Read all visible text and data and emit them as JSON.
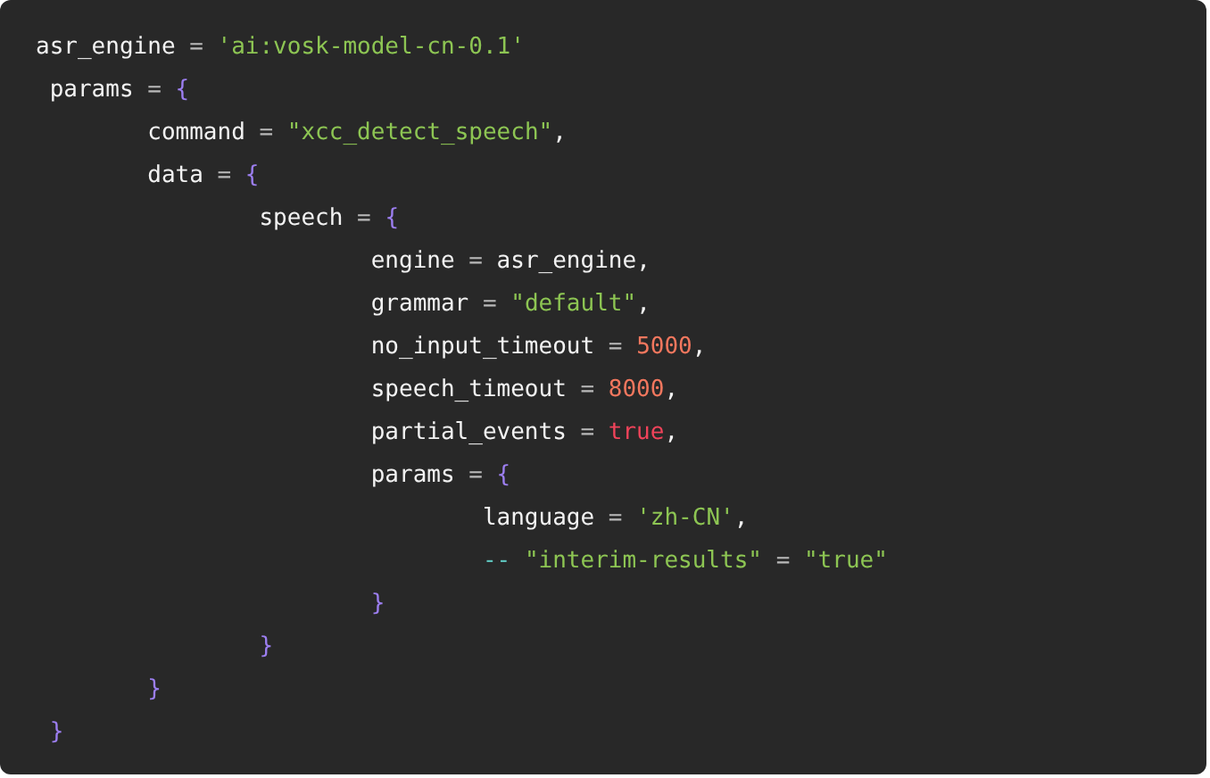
{
  "code_block": {
    "lines": [
      [
        {
          "kind": "plain",
          "text": "asr_engine "
        },
        {
          "kind": "operator",
          "text": "= "
        },
        {
          "kind": "string",
          "text": "'ai:vosk-model-cn-0.1'"
        }
      ],
      [
        {
          "kind": "plain",
          "text": " params "
        },
        {
          "kind": "operator",
          "text": "= "
        },
        {
          "kind": "brace",
          "text": "{"
        }
      ],
      [
        {
          "kind": "plain",
          "text": "\tcommand "
        },
        {
          "kind": "operator",
          "text": "= "
        },
        {
          "kind": "string",
          "text": "\"xcc_detect_speech\""
        },
        {
          "kind": "plain",
          "text": ","
        }
      ],
      [
        {
          "kind": "plain",
          "text": "\tdata "
        },
        {
          "kind": "operator",
          "text": "= "
        },
        {
          "kind": "brace",
          "text": "{"
        }
      ],
      [
        {
          "kind": "plain",
          "text": "\t\tspeech "
        },
        {
          "kind": "operator",
          "text": "= "
        },
        {
          "kind": "brace",
          "text": "{"
        }
      ],
      [
        {
          "kind": "plain",
          "text": "\t\t\tengine "
        },
        {
          "kind": "operator",
          "text": "= "
        },
        {
          "kind": "plain",
          "text": "asr_engine,"
        }
      ],
      [
        {
          "kind": "plain",
          "text": "\t\t\tgrammar "
        },
        {
          "kind": "operator",
          "text": "= "
        },
        {
          "kind": "string",
          "text": "\"default\""
        },
        {
          "kind": "plain",
          "text": ","
        }
      ],
      [
        {
          "kind": "plain",
          "text": "\t\t\tno_input_timeout "
        },
        {
          "kind": "operator",
          "text": "= "
        },
        {
          "kind": "number",
          "text": "5000"
        },
        {
          "kind": "plain",
          "text": ","
        }
      ],
      [
        {
          "kind": "plain",
          "text": "\t\t\tspeech_timeout "
        },
        {
          "kind": "operator",
          "text": "= "
        },
        {
          "kind": "number",
          "text": "8000"
        },
        {
          "kind": "plain",
          "text": ","
        }
      ],
      [
        {
          "kind": "plain",
          "text": "\t\t\tpartial_events "
        },
        {
          "kind": "operator",
          "text": "= "
        },
        {
          "kind": "boolean",
          "text": "true"
        },
        {
          "kind": "plain",
          "text": ","
        }
      ],
      [
        {
          "kind": "plain",
          "text": "\t\t\tparams "
        },
        {
          "kind": "operator",
          "text": "= "
        },
        {
          "kind": "brace",
          "text": "{"
        }
      ],
      [
        {
          "kind": "plain",
          "text": "\t\t\t\tlanguage "
        },
        {
          "kind": "operator",
          "text": "= "
        },
        {
          "kind": "string",
          "text": "'zh-CN'"
        },
        {
          "kind": "plain",
          "text": ","
        }
      ],
      [
        {
          "kind": "comment",
          "text": "\t\t\t\t-- "
        },
        {
          "kind": "string",
          "text": "\"interim-results\""
        },
        {
          "kind": "operator",
          "text": " = "
        },
        {
          "kind": "string",
          "text": "\"true\""
        }
      ],
      [
        {
          "kind": "brace",
          "text": "\t\t\t}"
        }
      ],
      [
        {
          "kind": "brace",
          "text": "\t\t}"
        }
      ],
      [
        {
          "kind": "brace",
          "text": "\t}"
        }
      ],
      [
        {
          "kind": "brace",
          "text": " }"
        }
      ]
    ]
  }
}
